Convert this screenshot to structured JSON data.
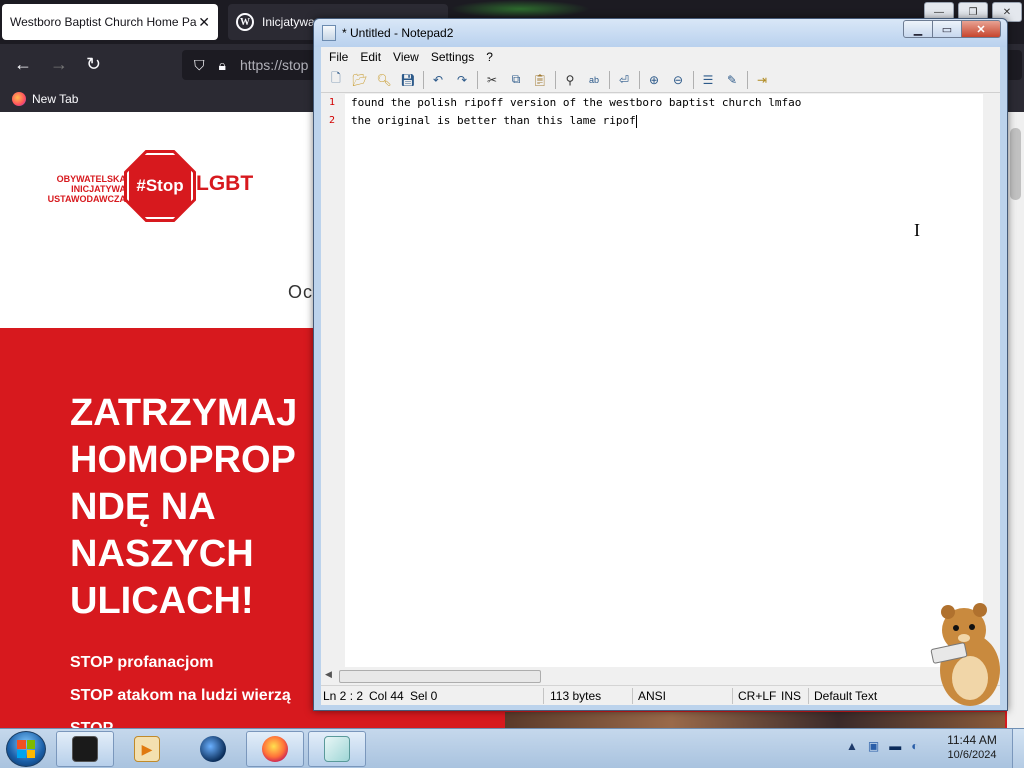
{
  "browser": {
    "tabs": [
      {
        "title": "Westboro Baptist Church Home Pa",
        "active": true
      },
      {
        "title": "Inicjatywa",
        "active": false
      }
    ],
    "nav": {
      "back_icon": "back-arrow-icon",
      "forward_icon": "forward-arrow-icon",
      "reload_icon": "reload-icon"
    },
    "url": "https://stop",
    "bookmark": "New Tab",
    "page": {
      "logo_small_text": "OBYWATELSKA INICJATYWA USTAWODAWCZA",
      "logo_badge": "#Stop",
      "logo_word": "LGBT",
      "fragment": "Oc",
      "headline_lines": [
        "ZATRZYMAJ",
        "HOMOPROP",
        "NDĘ NA",
        "NASZYCH",
        "ULICACH!"
      ],
      "stop_items": [
        "STOP profanacjom",
        "STOP atakom na ludzi wierzą",
        "STOP"
      ]
    }
  },
  "notepad": {
    "title": "* Untitled - Notepad2",
    "menu": [
      "File",
      "Edit",
      "View",
      "Settings",
      "?"
    ],
    "toolbar_icons": [
      "new-icon",
      "open-icon",
      "browse-icon",
      "save-icon",
      "undo-icon",
      "redo-icon",
      "cut-icon",
      "copy-icon",
      "paste-icon",
      "find-icon",
      "replace-icon",
      "wordwrap-icon",
      "zoom-in-icon",
      "zoom-out-icon",
      "scheme-icon",
      "customize-scheme-icon",
      "exit-icon"
    ],
    "lines": [
      {
        "num": "1",
        "text": "found the polish ripoff version of the westboro baptist church lmfao"
      },
      {
        "num": "2",
        "text": "the original is better than this lame ripof"
      }
    ],
    "status": {
      "position": "Ln 2 : 2",
      "col": "Col 44",
      "sel": "Sel 0",
      "size": "113 bytes",
      "encoding": "ANSI",
      "eol": "CR+LF",
      "mode": "INS",
      "scheme": "Default Text"
    }
  },
  "taskbar": {
    "apps": [
      "terminal-icon",
      "media-player-icon",
      "globe-icon",
      "firefox-icon",
      "notepad2-icon"
    ],
    "clock_time": "11:44 AM",
    "clock_date": "10/6/2024"
  },
  "colors": {
    "red": "#d7191e",
    "firefox_dark": "#1c1b22",
    "taskbar": "#b9cfe6"
  }
}
